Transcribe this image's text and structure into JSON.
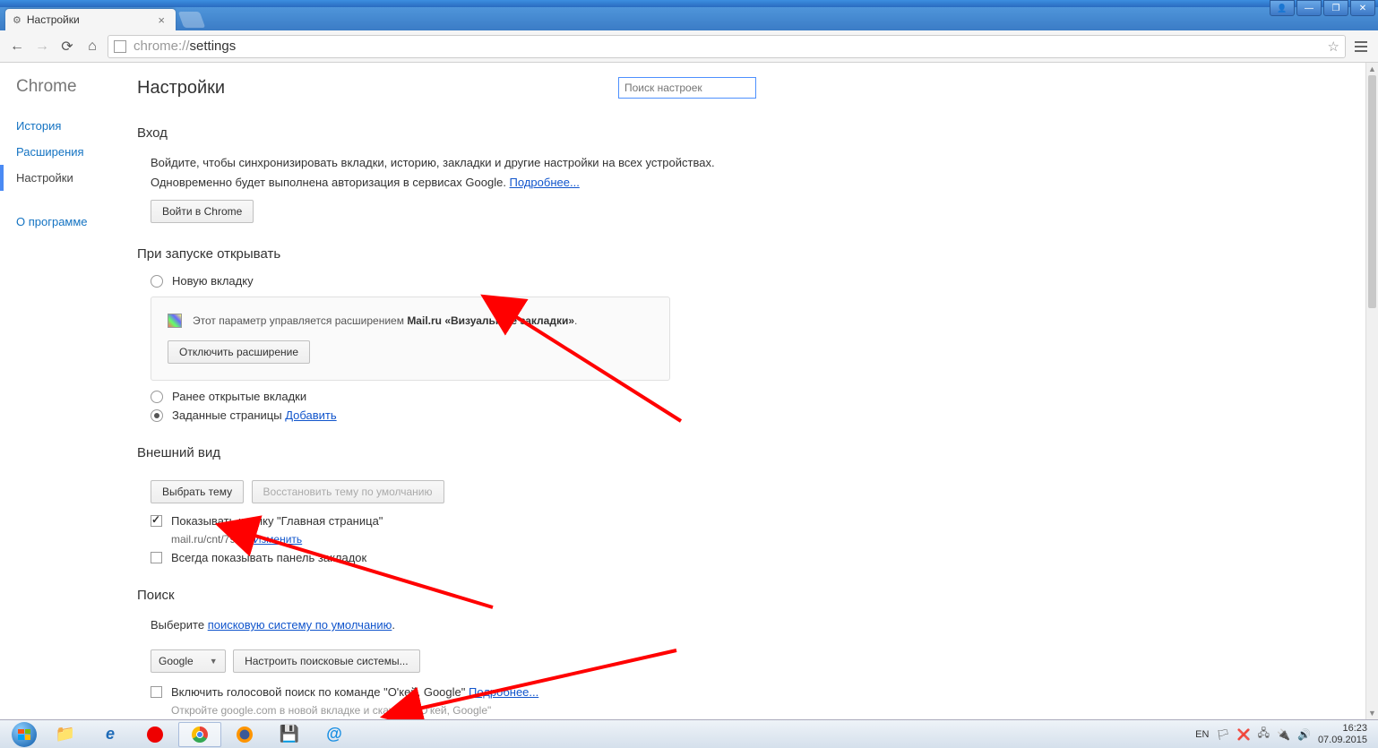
{
  "window": {
    "tab_title": "Настройки",
    "url_prefix": "chrome://",
    "url_path": "settings"
  },
  "nav": {
    "brand": "Chrome",
    "history": "История",
    "extensions": "Расширения",
    "settings": "Настройки",
    "about": "О программе"
  },
  "page_header": "Настройки",
  "search_placeholder": "Поиск настроек",
  "login": {
    "heading": "Вход",
    "line1": "Войдите, чтобы синхронизировать вкладки, историю, закладки и другие настройки на всех устройствах.",
    "line2_a": "Одновременно будет выполнена авторизация в сервисах Google. ",
    "line2_link": "Подробнее...",
    "button": "Войти в Chrome"
  },
  "startup": {
    "heading": "При запуске открывать",
    "opt_newtab": "Новую вкладку",
    "ext_text_a": "Этот параметр управляется расширением ",
    "ext_text_b": "Mail.ru «Визуальные закладки»",
    "ext_text_c": ".",
    "disable_btn": "Отключить расширение",
    "opt_prev": "Ранее открытые вкладки",
    "opt_pages": "Заданные страницы ",
    "opt_pages_link": "Добавить"
  },
  "appearance": {
    "heading": "Внешний вид",
    "choose_theme": "Выбрать тему",
    "reset_theme": "Восстановить тему по умолчанию",
    "show_home": "Показывать кнопку \"Главная страница\"",
    "home_url": "mail.ru/cnt/7993/ ",
    "home_change": "Изменить",
    "show_bookmarks": "Всегда показывать панель закладок"
  },
  "search": {
    "heading": "Поиск",
    "choose_text_a": "Выберите ",
    "choose_link": "поисковую систему по умолчанию",
    "choose_text_b": ".",
    "engine": "Google",
    "manage_btn": "Настроить поисковые системы...",
    "voice_label": "Включить голосовой поиск по команде \"О'кей, Google\" ",
    "voice_link": "Подробнее...",
    "voice_sub": "Откройте google.com в новой вкладке и скажите \"О'кей, Google\""
  },
  "tray": {
    "lang": "EN",
    "time": "16:23",
    "date": "07.09.2015"
  }
}
